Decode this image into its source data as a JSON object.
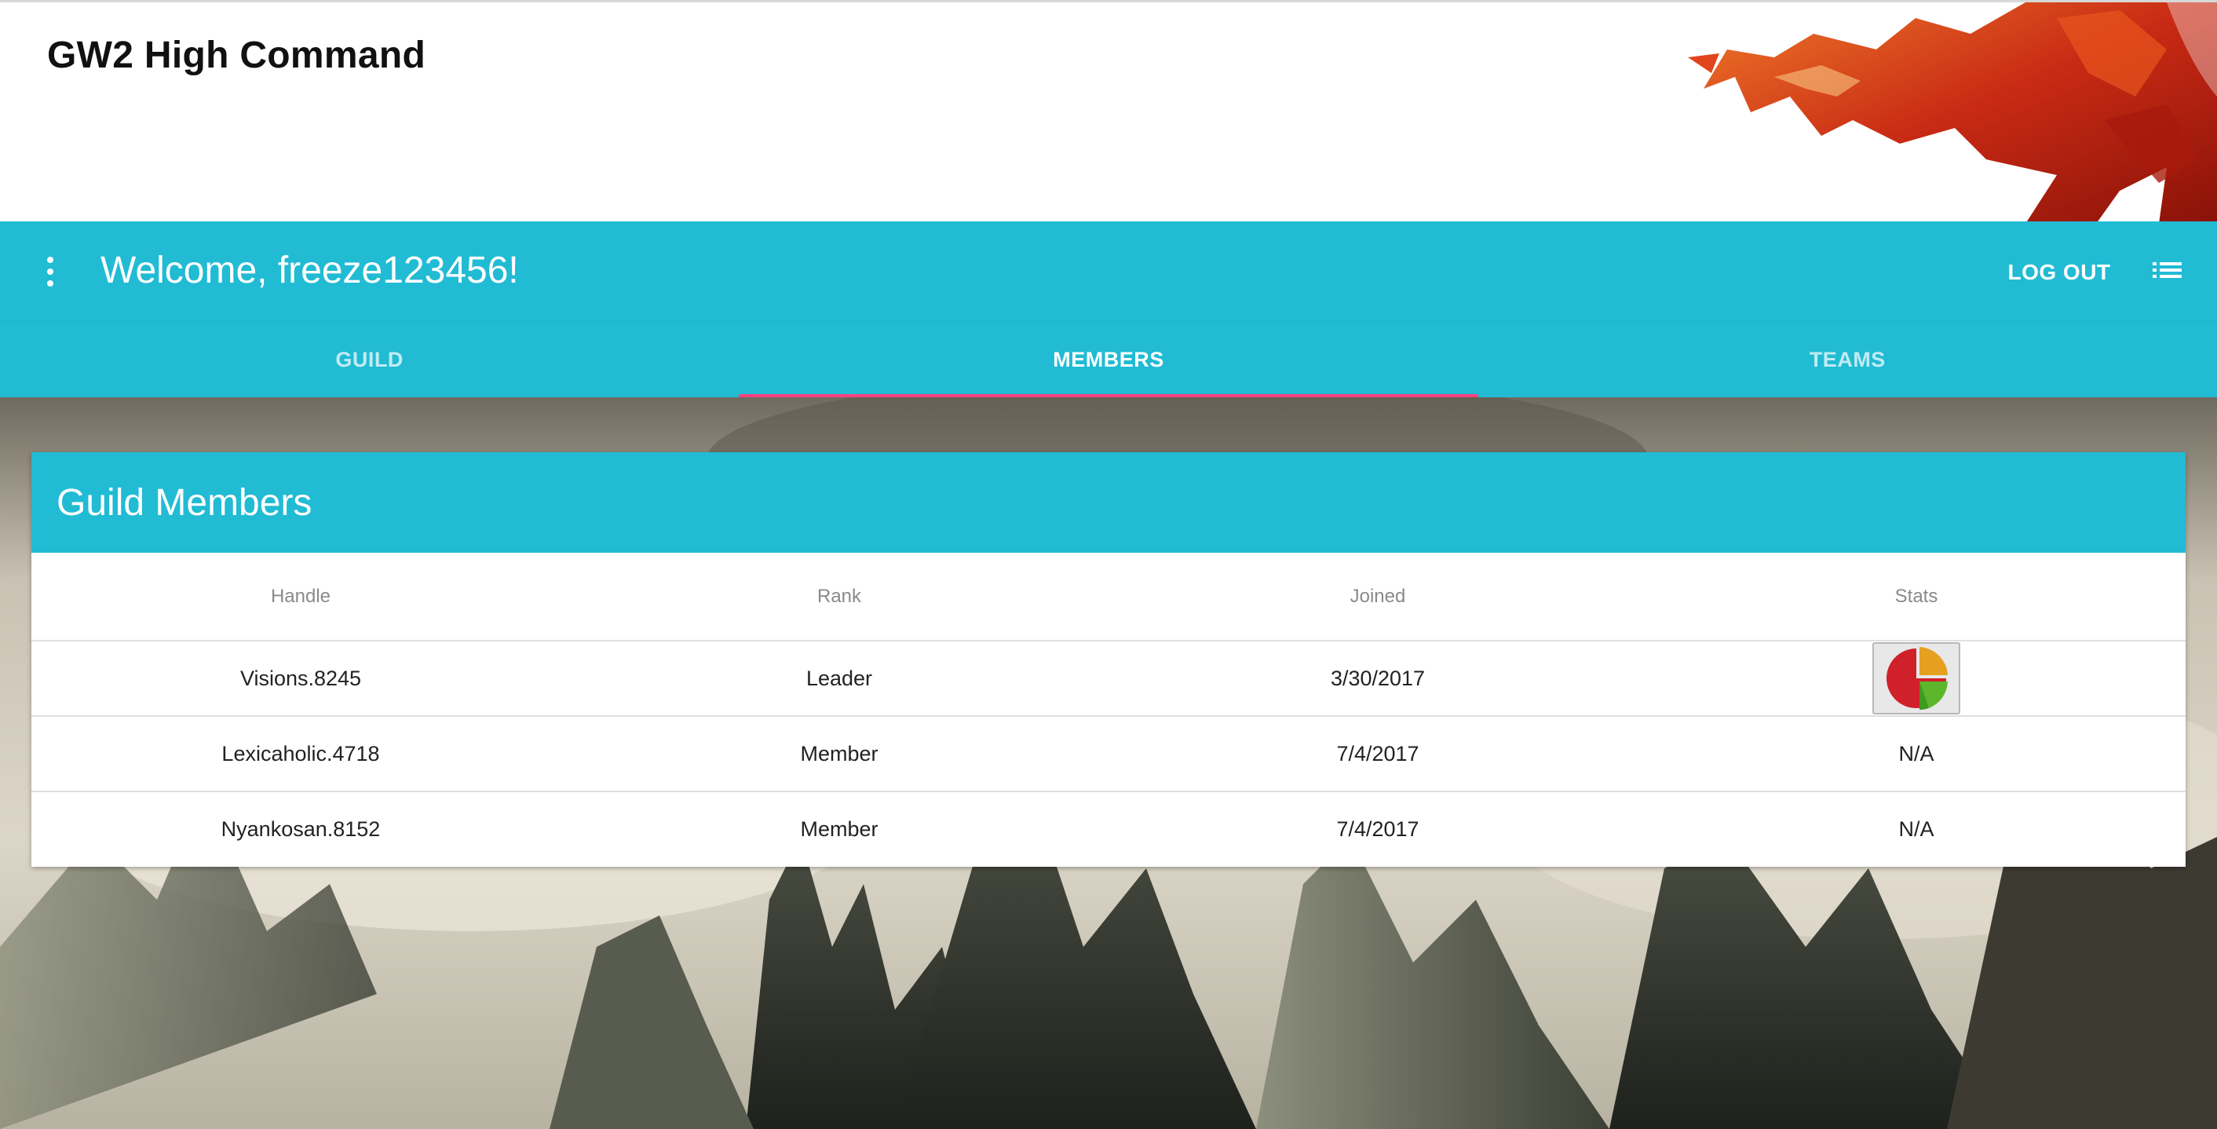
{
  "header": {
    "title": "GW2 High Command"
  },
  "app_bar": {
    "welcome": "Welcome, freeze123456!",
    "logout_label": "LOG OUT",
    "menu_icon": "more-vert-icon",
    "list_icon": "list-icon"
  },
  "tabs": [
    {
      "label": "GUILD",
      "active": false
    },
    {
      "label": "MEMBERS",
      "active": true
    },
    {
      "label": "TEAMS",
      "active": false
    }
  ],
  "members_card": {
    "title": "Guild Members",
    "columns": [
      "Handle",
      "Rank",
      "Joined",
      "Stats"
    ],
    "rows": [
      {
        "handle": "Visions.8245",
        "rank": "Leader",
        "joined": "3/30/2017",
        "stats": "pie-chart-icon"
      },
      {
        "handle": "Lexicaholic.4718",
        "rank": "Member",
        "joined": "7/4/2017",
        "stats": "N/A"
      },
      {
        "handle": "Nyankosan.8152",
        "rank": "Member",
        "joined": "7/4/2017",
        "stats": "N/A"
      }
    ]
  },
  "colors": {
    "primary": "#21bbd4",
    "accent": "#ff4081"
  }
}
